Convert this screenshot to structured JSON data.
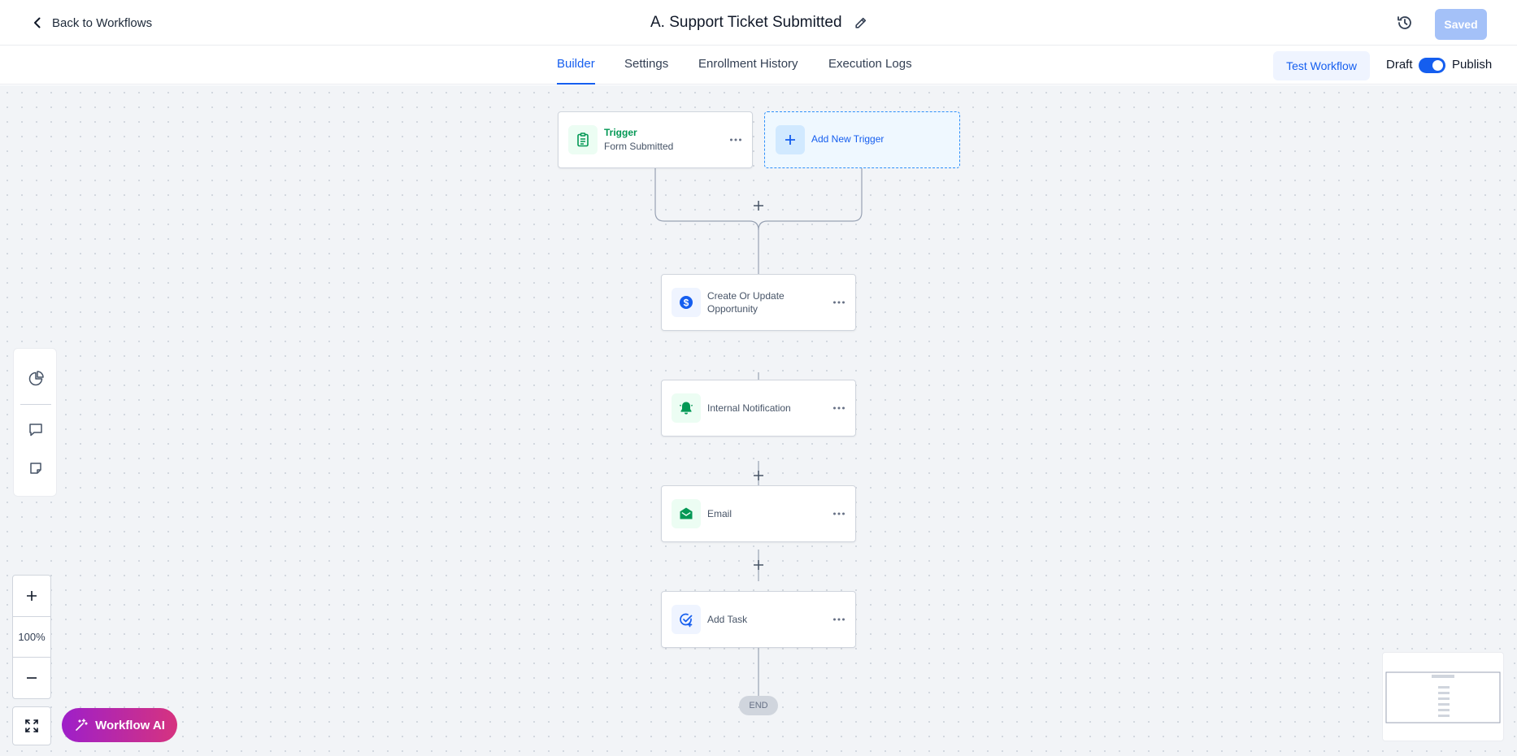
{
  "header": {
    "back_label": "Back to Workflows",
    "title": "A. Support Ticket Submitted",
    "saved_label": "Saved"
  },
  "tabs": [
    {
      "label": "Builder",
      "active": true
    },
    {
      "label": "Settings",
      "active": false
    },
    {
      "label": "Enrollment History",
      "active": false
    },
    {
      "label": "Execution Logs",
      "active": false
    }
  ],
  "toolbar": {
    "test_label": "Test Workflow",
    "draft_label": "Draft",
    "publish_label": "Publish",
    "publish_on": true
  },
  "trigger": {
    "title": "Trigger",
    "subtitle": "Form Submitted",
    "add_label": "Add New Trigger"
  },
  "actions": [
    {
      "label": "Create Or Update Opportunity",
      "icon": "dollar-icon",
      "color": "#155eef"
    },
    {
      "label": "Internal Notification",
      "icon": "bell-icon",
      "color": "#039855"
    },
    {
      "label": "Email",
      "icon": "mail-open-icon",
      "color": "#039855"
    },
    {
      "label": "Add Task",
      "icon": "task-check-icon",
      "color": "#155eef"
    }
  ],
  "end_label": "END",
  "zoom": {
    "value": "100%"
  },
  "ai_label": "Workflow AI",
  "colors": {
    "primary": "#155eef",
    "green": "#039855",
    "ai_gradient_start": "#9e1fc9",
    "ai_gradient_end": "#d6337f"
  }
}
